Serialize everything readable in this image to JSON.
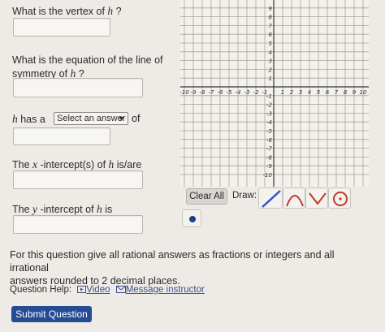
{
  "questions": {
    "q1": {
      "prefix": "What is the vertex of ",
      "var": "h",
      "suffix": " ?"
    },
    "q2": {
      "line1": "What is the equation of the line of",
      "line2_prefix": "symmetry of ",
      "var": "h",
      "suffix": " ?"
    },
    "q3": {
      "var": "h",
      "prefix": " has a ",
      "select_value": "Select an answer",
      "suffix": " of"
    },
    "q4": {
      "prefix": "The ",
      "var_x": "x",
      "mid": " -intercept(s) of ",
      "var": "h",
      "suffix": " is/are"
    },
    "q5": {
      "prefix": "The ",
      "var_y": "y",
      "mid": " -intercept of ",
      "var": "h",
      "suffix": " is"
    }
  },
  "graph": {
    "x_min": -10,
    "x_max": 10,
    "y_min": -10,
    "y_max": 9,
    "x_tick_labels": [
      "-10",
      "-9",
      "-8",
      "-7",
      "-6",
      "-5",
      "-4",
      "-3",
      "-2",
      "-1",
      "1",
      "2",
      "3",
      "4",
      "5",
      "6",
      "7",
      "8",
      "9",
      "10"
    ],
    "y_tick_labels": [
      "9",
      "8",
      "7",
      "6",
      "5",
      "4",
      "3",
      "2",
      "1",
      "-1",
      "-2",
      "-3",
      "-4",
      "-5",
      "-6",
      "-7",
      "-8",
      "-9",
      "-10"
    ]
  },
  "tools": {
    "clear_all": "Clear All",
    "draw_label": "Draw:",
    "tool_icons": [
      "line-tool-icon",
      "parabola-up-tool-icon",
      "parabola-down-tool-icon",
      "circle-tool-icon",
      "point-tool-icon"
    ]
  },
  "instructions": {
    "line1": "For this question give all rational answers as fractions or integers and all irrational",
    "line2": "answers rounded to 2 decimal places."
  },
  "help": {
    "label": "Question Help:",
    "video": "Video",
    "message": "Message instructor"
  },
  "submit_label": "Submit Question",
  "colors": {
    "accent": "#244b93",
    "tool_line": "#2a55c8",
    "tool_curve": "#c0392b",
    "point": "#1c3f8a"
  }
}
